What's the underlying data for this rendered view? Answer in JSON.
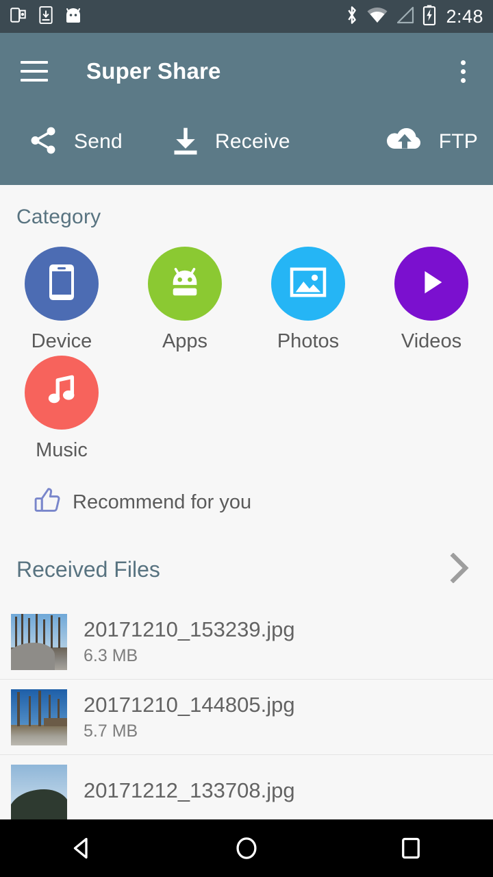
{
  "status_bar": {
    "time": "2:48",
    "left_icons": [
      "screen-cast-icon",
      "download-to-phone-icon",
      "android-head-icon"
    ],
    "right_icons": [
      "bluetooth-icon",
      "wifi-icon",
      "cell-signal-icon",
      "battery-charging-icon"
    ],
    "background": "#3C4A52"
  },
  "app_bar": {
    "title": "Super Share",
    "menu_icon": "hamburger-menu-icon",
    "overflow_icon": "overflow-menu-icon",
    "background": "#5C7A87",
    "actions": [
      {
        "label": "Send",
        "icon": "share-icon"
      },
      {
        "label": "Receive",
        "icon": "download-icon"
      },
      {
        "label": "FTP",
        "icon": "cloud-upload-icon"
      }
    ]
  },
  "category": {
    "title": "Category",
    "items": [
      {
        "label": "Device",
        "icon": "smartphone-icon",
        "color": "#4C6CB3"
      },
      {
        "label": "Apps",
        "icon": "android-icon",
        "color": "#8BC932"
      },
      {
        "label": "Photos",
        "icon": "image-icon",
        "color": "#25B5F5"
      },
      {
        "label": "Videos",
        "icon": "play-icon",
        "color": "#7B10CF"
      },
      {
        "label": "Music",
        "icon": "music-note-icon",
        "color": "#F7635C"
      }
    ]
  },
  "recommend": {
    "label": "Recommend for you",
    "icon": "thumbs-up-icon",
    "icon_color": "#7986CB"
  },
  "received_files": {
    "title": "Received Files",
    "chevron_icon": "chevron-right-icon",
    "items": [
      {
        "name": "20171210_153239.jpg",
        "size": "6.3 MB",
        "thumb": "road-with-bare-trees"
      },
      {
        "name": "20171210_144805.jpg",
        "size": "5.7 MB",
        "thumb": "bare-trees-blue-sky"
      },
      {
        "name": "20171212_133708.jpg",
        "size": "",
        "thumb": "ridge-against-sky"
      }
    ]
  },
  "nav_bar": {
    "back": "back-icon",
    "home": "home-icon",
    "recents": "recents-icon"
  }
}
